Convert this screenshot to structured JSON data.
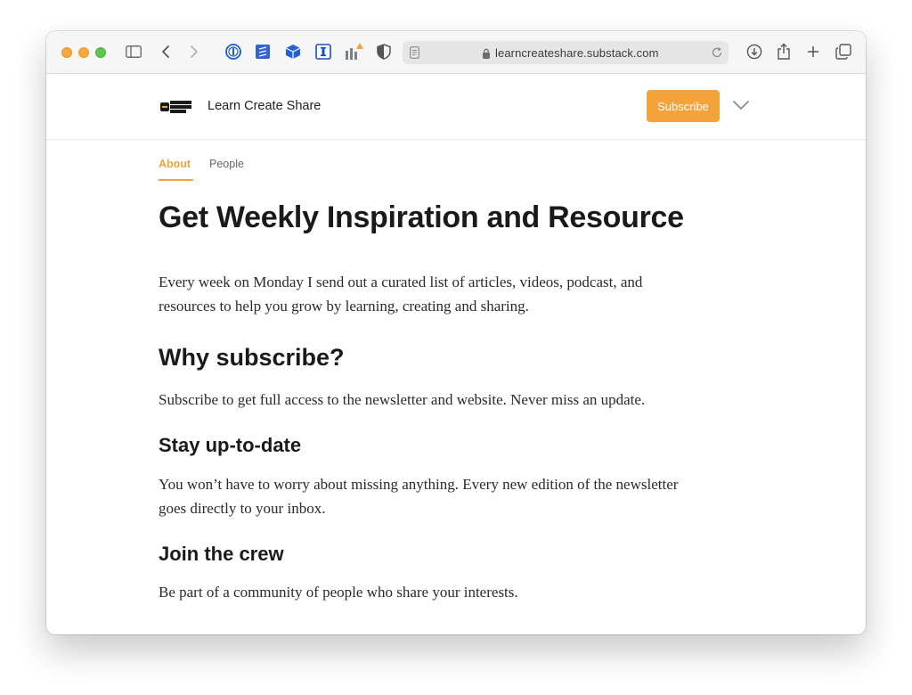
{
  "browser": {
    "url": "learncreateshare.substack.com"
  },
  "site": {
    "logo_text": "LEARN CREATE SHARE",
    "name": "Learn Create Share",
    "subscribe_label": "Subscribe"
  },
  "tabs": [
    {
      "label": "About",
      "active": true
    },
    {
      "label": "People",
      "active": false
    }
  ],
  "article": {
    "title": "Get Weekly Inspiration and Resource",
    "intro_line1": "Every week on Monday I send out a curated list of articles, videos, podcast, and",
    "intro_line2": "resources to help you grow by learning, creating and sharing.",
    "why_heading": "Why subscribe?",
    "why_text": "Subscribe to get full access to the newsletter and website. Never miss an update.",
    "stay_heading": "Stay up-to-date",
    "stay_line1": "You won’t have to worry about missing anything. Every new edition of the newsletter",
    "stay_line2": "goes directly to your inbox.",
    "crew_heading": "Join the crew",
    "crew_text": "Be part of a community of people who share your interests."
  },
  "colors": {
    "accent": "#f3a33a",
    "text": "#1a1a1a"
  },
  "icons": [
    "sidebar-icon",
    "back-icon",
    "forward-icon",
    "password-manager-icon",
    "notes-extension-icon",
    "box-extension-icon",
    "instapaper-icon",
    "stats-extension-icon",
    "shield-icon",
    "reader-icon",
    "lock-icon",
    "reload-icon",
    "download-icon",
    "share-icon",
    "new-tab-icon",
    "tabs-overview-icon",
    "chevron-down-icon"
  ]
}
